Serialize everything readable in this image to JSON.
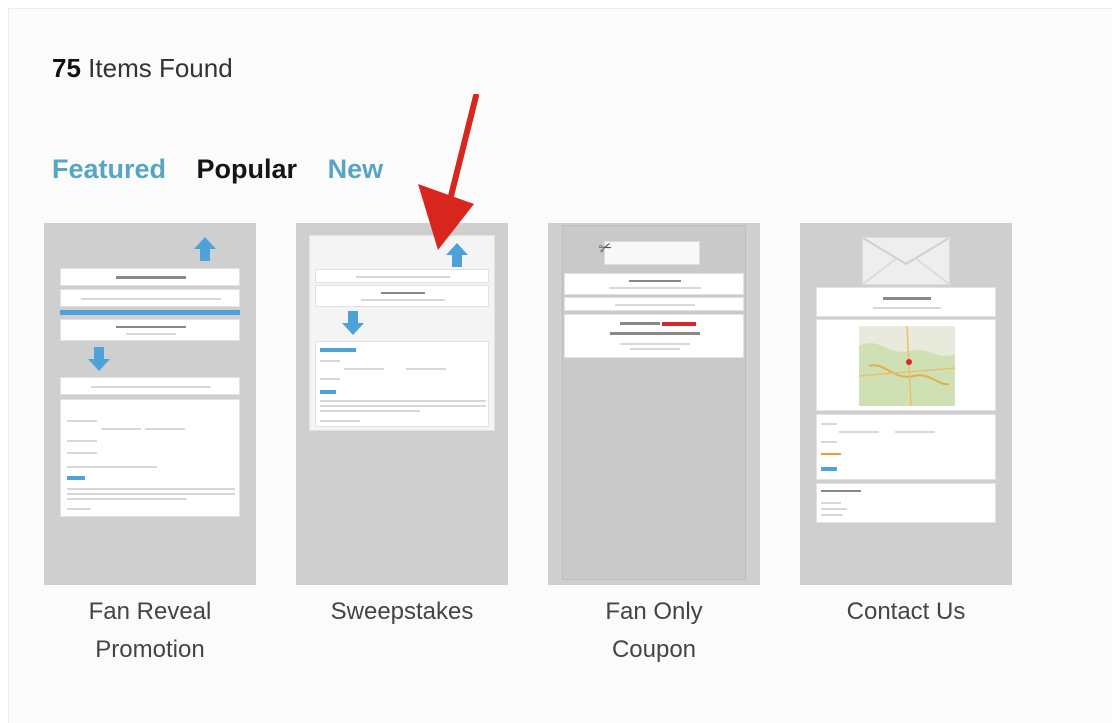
{
  "results": {
    "count": "75",
    "label": "Items Found"
  },
  "tabs": [
    {
      "label": "Featured",
      "state": "link"
    },
    {
      "label": "Popular",
      "state": "active"
    },
    {
      "label": "New",
      "state": "link"
    }
  ],
  "templates": [
    {
      "title_line1": "Fan Reveal",
      "title_line2": "Promotion"
    },
    {
      "title_line1": "Sweepstakes",
      "title_line2": ""
    },
    {
      "title_line1": "Fan Only",
      "title_line2": "Coupon"
    },
    {
      "title_line1": "Contact Us",
      "title_line2": ""
    }
  ],
  "colors": {
    "tab_link": "#56a6c3",
    "tab_active": "#151515",
    "thumb_bg": "#cfcfcf",
    "accent_blue": "#4da3d9",
    "pointer_arrow": "#d8261f"
  }
}
